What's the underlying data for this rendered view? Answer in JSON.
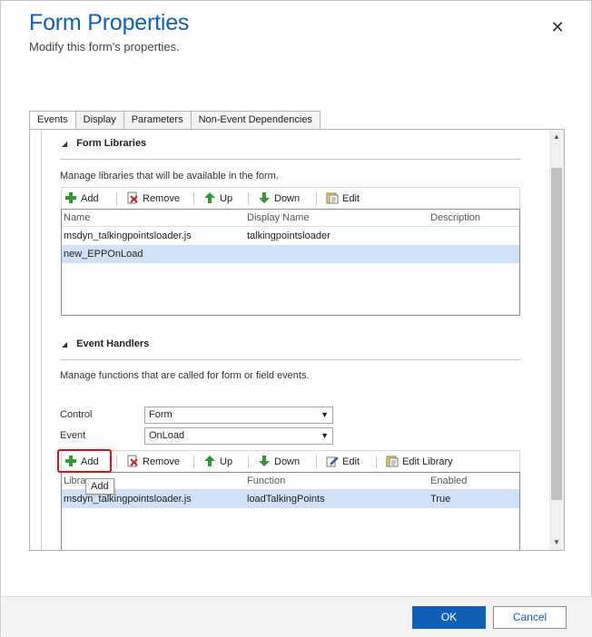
{
  "dialog": {
    "title": "Form Properties",
    "subtitle": "Modify this form's properties.",
    "close_glyph": "✕"
  },
  "tabs": [
    {
      "label": "Events",
      "active": true
    },
    {
      "label": "Display",
      "active": false
    },
    {
      "label": "Parameters",
      "active": false
    },
    {
      "label": "Non-Event Dependencies",
      "active": false
    }
  ],
  "form_libraries": {
    "header": "Form Libraries",
    "description": "Manage libraries that will be available in the form.",
    "toolbar": {
      "add": "Add",
      "remove": "Remove",
      "up": "Up",
      "down": "Down",
      "edit": "Edit"
    },
    "columns": [
      "Name",
      "Display Name",
      "Description"
    ],
    "rows": [
      {
        "name": "msdyn_talkingpointsloader.js",
        "display_name": "talkingpointsloader",
        "description": "",
        "selected": false
      },
      {
        "name": "new_EPPOnLoad",
        "display_name": "",
        "description": "",
        "selected": true
      }
    ]
  },
  "event_handlers": {
    "header": "Event Handlers",
    "description": "Manage functions that are called for form or field events.",
    "control_label": "Control",
    "control_value": "Form",
    "event_label": "Event",
    "event_value": "OnLoad",
    "toolbar": {
      "add": "Add",
      "remove": "Remove",
      "up": "Up",
      "down": "Down",
      "edit": "Edit",
      "edit_library": "Edit Library"
    },
    "columns": [
      "Library",
      "Function",
      "Enabled"
    ],
    "rows": [
      {
        "library": "msdyn_talkingpointsloader.js",
        "function": "loadTalkingPoints",
        "enabled": "True",
        "selected": true
      }
    ],
    "tooltip": "Add"
  },
  "footer": {
    "ok": "OK",
    "cancel": "Cancel"
  },
  "colors": {
    "accent": "#1160b7",
    "selection": "#cfe2f8",
    "highlight": "#e01010",
    "add_icon": "#2e9b2e"
  }
}
